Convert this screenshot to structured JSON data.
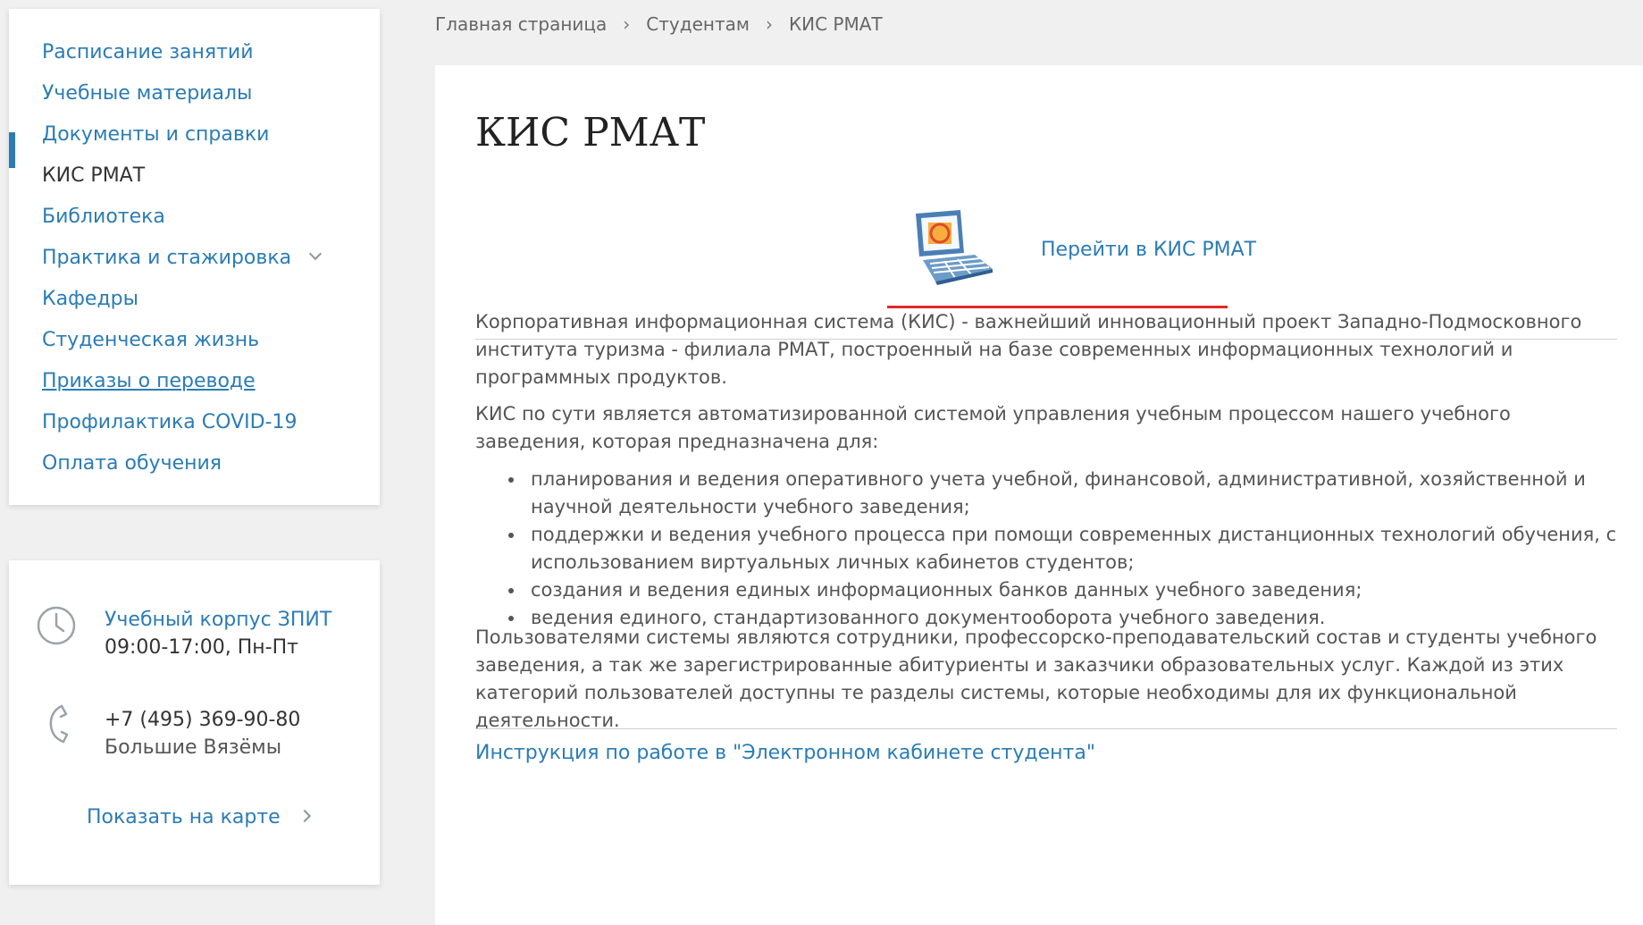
{
  "breadcrumb": {
    "items": [
      "Главная страница",
      "Студентам",
      "КИС РМАТ"
    ],
    "separator": "›"
  },
  "sidebar": {
    "items": [
      {
        "label": "Расписание занятий"
      },
      {
        "label": "Учебные материалы"
      },
      {
        "label": "Документы и справки"
      },
      {
        "label": "КИС РМАТ",
        "active": true
      },
      {
        "label": "Библиотека"
      },
      {
        "label": "Практика и стажировка",
        "has_submenu": true
      },
      {
        "label": "Кафедры"
      },
      {
        "label": "Студенческая жизнь"
      },
      {
        "label": "Приказы о переводе",
        "underlined": true
      },
      {
        "label": "Профилактика COVID-19"
      },
      {
        "label": "Оплата обучения"
      }
    ]
  },
  "contact": {
    "building": "Учебный корпус ЗПИТ",
    "hours": "09:00-17:00, Пн-Пт",
    "phone": "+7 (495) 369-90-80",
    "location": "Большие Вязёмы",
    "map_link": "Показать на карте"
  },
  "main": {
    "title": "КИС РМАТ",
    "kis_link": "Перейти в КИС РМАТ",
    "paragraph1": "Корпоративная информационная система (КИС) - важнейший инновационный проект Западно-Подмосковного института туризма - филиала РМАТ, построенный на базе современных информационных технологий и программных продуктов.",
    "paragraph2": "КИС по сути является автоматизированной системой управления учебным процессом нашего учебного заведения, которая предназначена для:",
    "bullets": [
      "планирования и ведения оперативного учета учебной, финансовой, административной, хозяйственной и научной деятельности учебного заведения;",
      "поддержки и ведения учебного процесса при помощи современных дистанционных технологий обучения, с использованием виртуальных личных кабинетов студентов;",
      "создания и ведения единых информационных банков данных учебного заведения;",
      "ведения единого, стандартизованного документооборота учебного заведения."
    ],
    "paragraph3": "Пользователями системы являются сотрудники, профессорско-преподавательский состав и студенты учебного заведения, а так же зарегистрированные абитуриенты и заказчики образовательных услуг. Каждой из этих категорий пользователей доступны те разделы системы, которые необходимы для их функциональной деятельности.",
    "instruction_link": "Инструкция по работе в \"Электронном кабинете студента\""
  },
  "icons": {
    "clock": "clock-icon",
    "phone": "phone-icon",
    "computer": "computer-icon",
    "chevron_down": "chevron-down-icon",
    "chevron_right": "chevron-right-icon"
  },
  "colors": {
    "link": "#2b7cb5",
    "active_bar": "#2b7cb5",
    "underline_accent": "#e02a2a",
    "page_bg": "#f0f0f0",
    "text": "#555555"
  }
}
